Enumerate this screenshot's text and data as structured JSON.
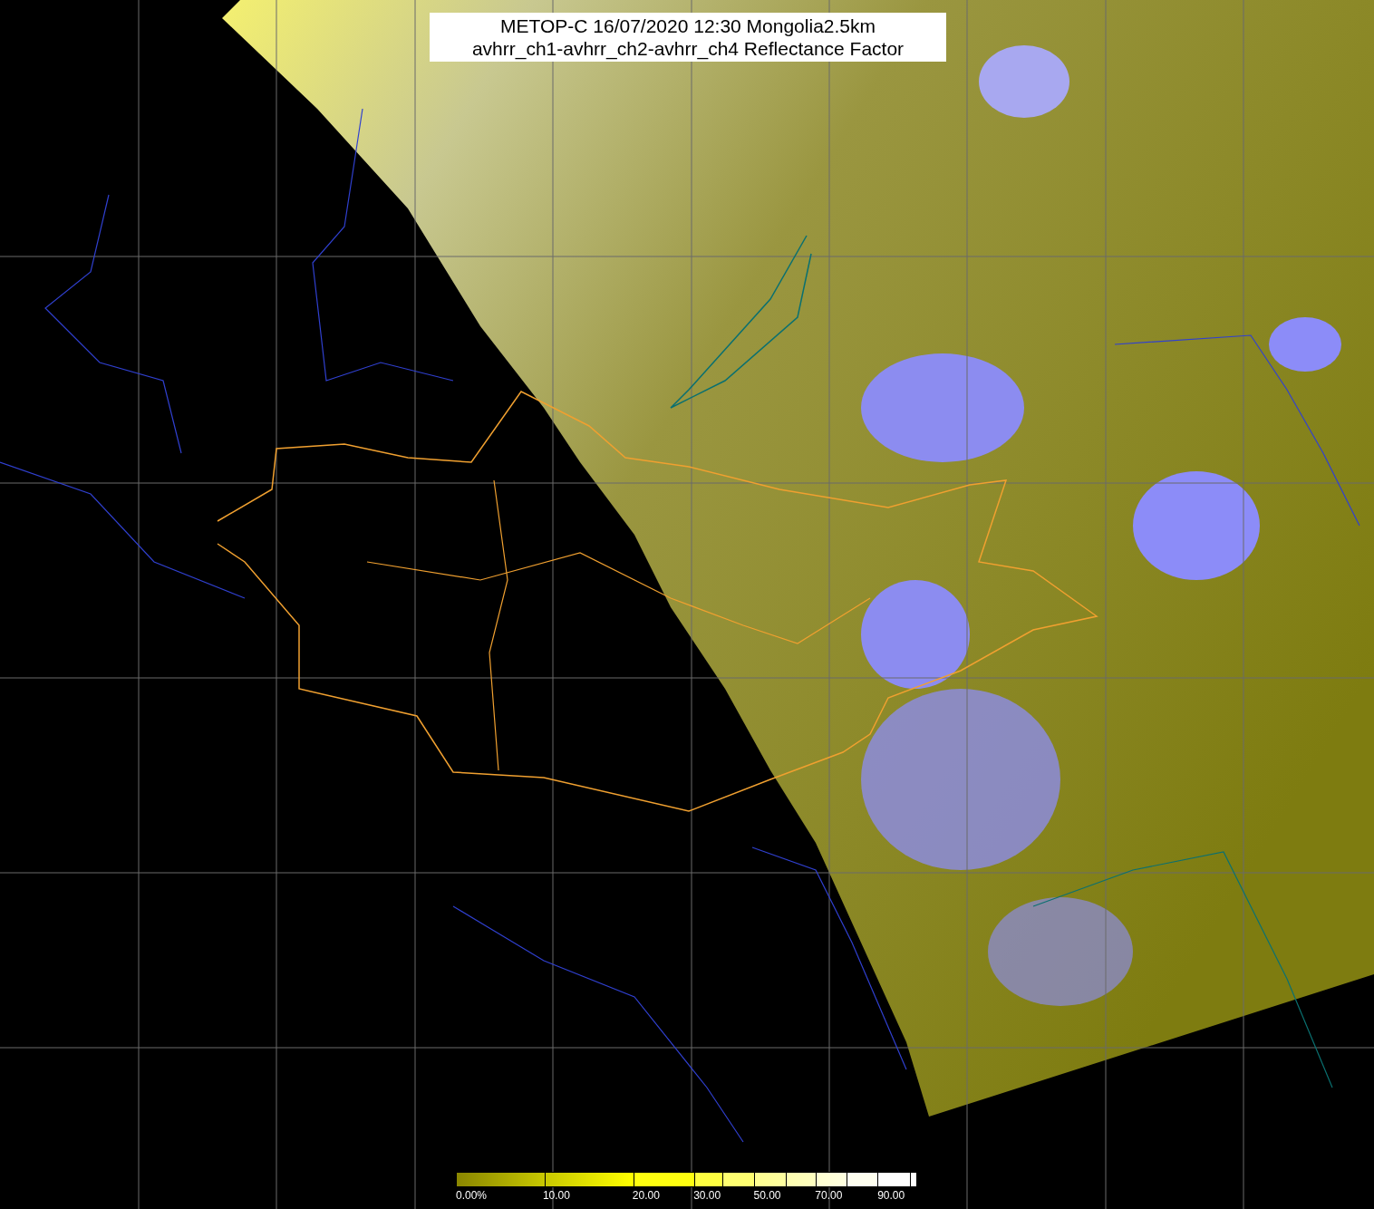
{
  "title": {
    "lines": [
      "METOP-C 16/07/2020 12:30 Mongolia2.5km",
      "avhrr_ch1-avhrr_ch2-avhrr_ch4 Reflectance Factor"
    ]
  },
  "colorbar": {
    "labels": [
      "0.00%",
      "10.00",
      "20.00",
      "30.00",
      "50.00",
      "70.00",
      "90.00"
    ]
  }
}
